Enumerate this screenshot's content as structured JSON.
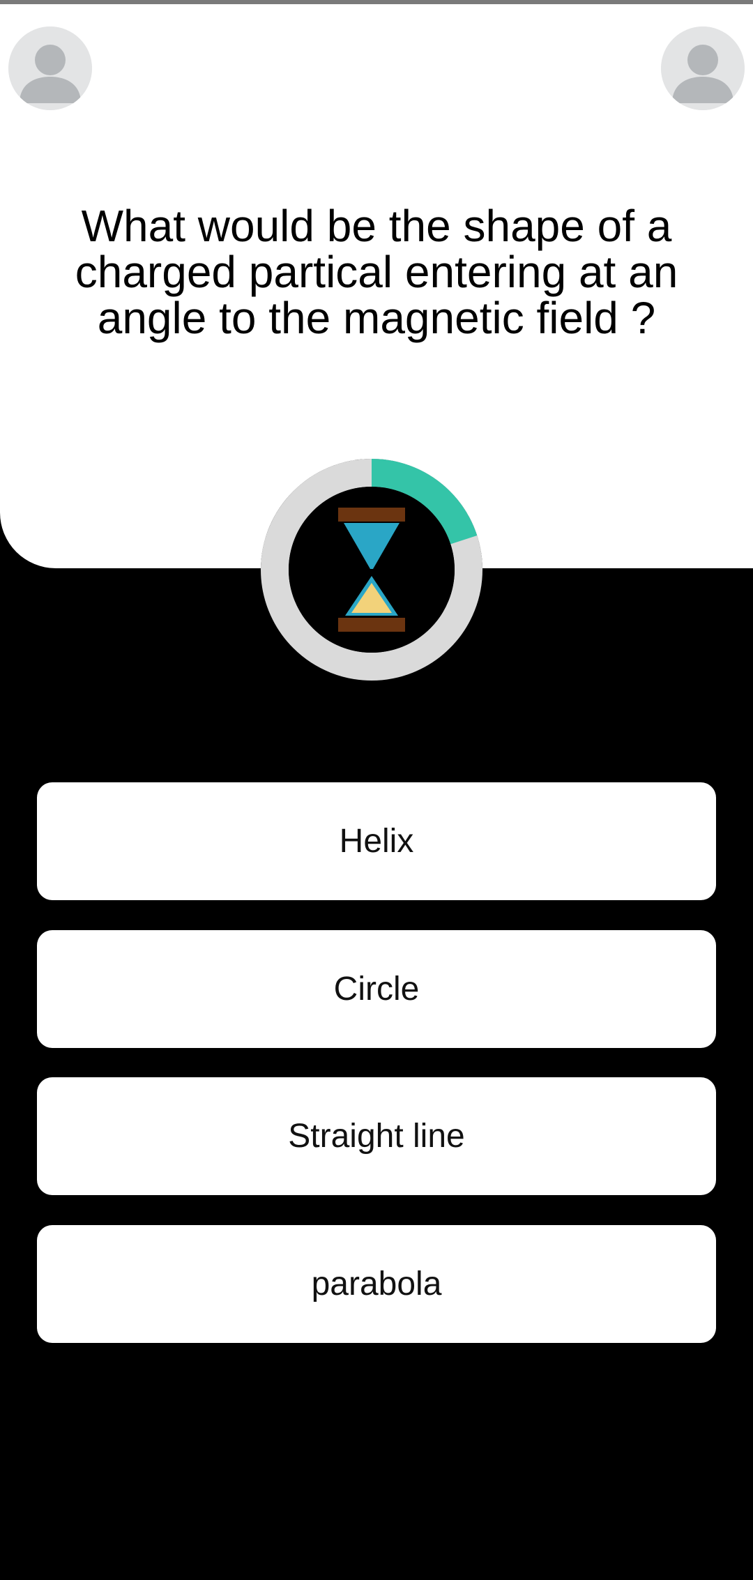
{
  "theme": {
    "panel_color": "#ffffff",
    "background_color": "#000000",
    "timer_progress_color": "#34c4a8",
    "timer_track_color": "#dadada",
    "hourglass_frame_color": "#6b3410",
    "hourglass_top_sand_color": "#2aa6c6",
    "hourglass_bottom_sand_color": "#f2d27a"
  },
  "players": {
    "left_avatar_icon": "user-avatar-icon",
    "right_avatar_icon": "user-avatar-icon"
  },
  "question": {
    "text": "What would be the shape of a charged partical entering at an angle to the magnetic field ?"
  },
  "timer": {
    "icon": "hourglass-icon",
    "remaining_fraction": 0.8
  },
  "answers": [
    {
      "label": "Helix"
    },
    {
      "label": "Circle"
    },
    {
      "label": "Straight line"
    },
    {
      "label": "parabola"
    }
  ]
}
